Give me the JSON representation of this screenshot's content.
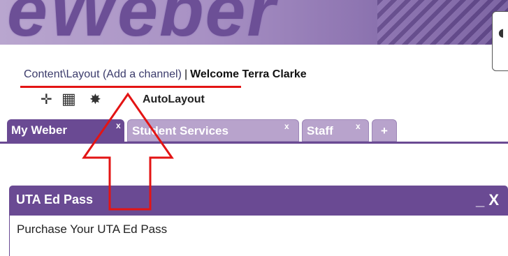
{
  "banner": {
    "logo_text": "eWeber"
  },
  "header": {
    "content_link": "Content\\Layout (Add a channel)",
    "separator": "|",
    "welcome": "Welcome Terra Clarke"
  },
  "toolbar": {
    "move_icon": "move-icon",
    "grid_icon": "grid-icon",
    "autolayout_icon": "autolayout-icon",
    "autolayout_label": "AutoLayout"
  },
  "tabs": [
    {
      "label": "My Weber",
      "close": "x",
      "active": true
    },
    {
      "label": "Student Services",
      "close": "x",
      "active": false
    },
    {
      "label": "Staff",
      "close": "x",
      "active": false
    },
    {
      "label": "+",
      "active": false
    }
  ],
  "channel": {
    "title": "UTA Ed Pass",
    "controls": "_ X",
    "body_text": "Purchase Your UTA Ed Pass"
  },
  "colors": {
    "accent": "#6a4a93",
    "tab_inactive": "#b8a3cc",
    "annotation": "#e31414"
  }
}
